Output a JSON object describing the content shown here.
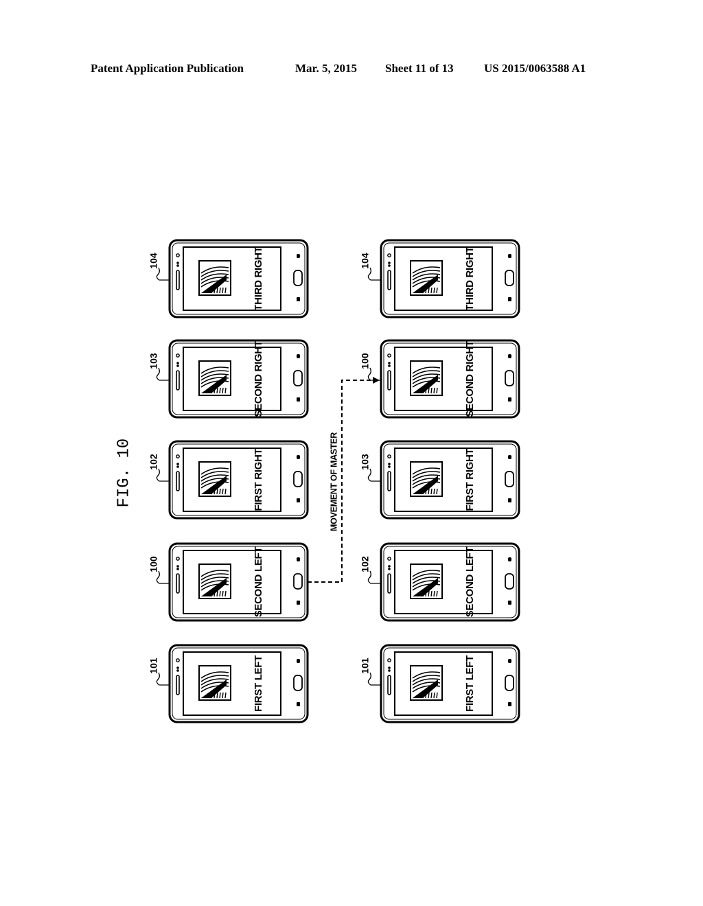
{
  "header": {
    "publication": "Patent Application Publication",
    "date": "Mar. 5, 2015",
    "sheet": "Sheet 11 of 13",
    "patent_number": "US 2015/0063588 A1"
  },
  "figure": {
    "label": "FIG. 10"
  },
  "before_column": [
    {
      "ref": "104",
      "screen_text": "THIRD RIGHT"
    },
    {
      "ref": "103",
      "screen_text": "SECOND RIGHT"
    },
    {
      "ref": "102",
      "screen_text": "FIRST RIGHT"
    },
    {
      "ref": "100",
      "screen_text": "SECOND LEFT"
    },
    {
      "ref": "101",
      "screen_text": "FIRST LEFT"
    }
  ],
  "after_column": [
    {
      "ref": "104",
      "screen_text": "THIRD RIGHT"
    },
    {
      "ref": "100",
      "screen_text": "SECOND RIGHT"
    },
    {
      "ref": "103",
      "screen_text": "FIRST RIGHT"
    },
    {
      "ref": "102",
      "screen_text": "SECOND LEFT"
    },
    {
      "ref": "101",
      "screen_text": "FIRST LEFT"
    }
  ],
  "arrow": {
    "label": "MOVEMENT OF MASTER",
    "from": "before_column.3",
    "to": "after_column.1"
  }
}
